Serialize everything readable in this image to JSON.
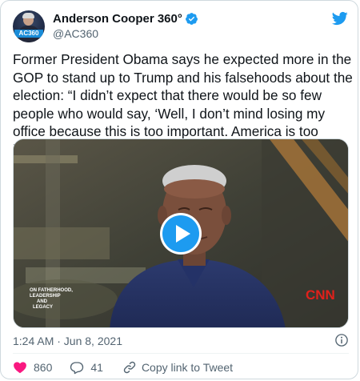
{
  "account": {
    "display_name": "Anderson Cooper 360°",
    "handle": "@AC360",
    "avatar_logo_text": "AC360"
  },
  "tweet": {
    "text": "Former President Obama says he expected more in the GOP to stand up to Trump and his falsehoods about the election: “I didn’t expect that there would be so few people who would say, ‘Well, I don’t mind losing my office because this is too important. America is too important.’”",
    "timestamp": "1:24 AM · Jun 8, 2021"
  },
  "media": {
    "caption_lines": [
      "ON FATHERHOOD,",
      "LEADERSHIP",
      "AND",
      "LEGACY"
    ],
    "network_logo": "CNN"
  },
  "actions": {
    "like_count": "860",
    "reply_count": "41",
    "copy_link_label": "Copy link to Tweet"
  },
  "colors": {
    "brand_blue": "#1d9bf0",
    "like_red": "#f91880",
    "text_primary": "#0f1419",
    "text_secondary": "#536471"
  }
}
